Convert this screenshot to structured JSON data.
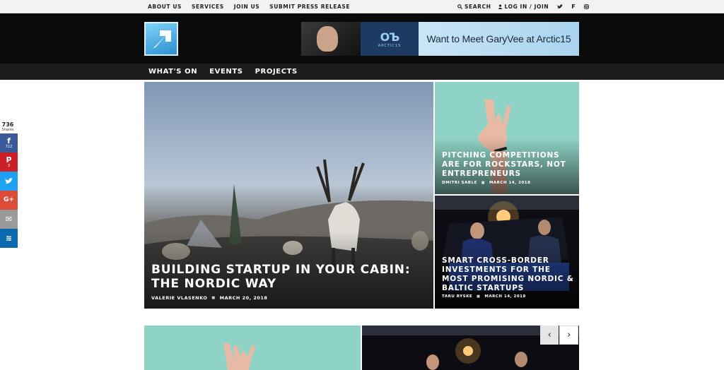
{
  "topbar": {
    "links": [
      "ABOUT US",
      "SERVICES",
      "JOIN US",
      "SUBMIT PRESS RELEASE"
    ],
    "search_label": "SEARCH",
    "login_label": "LOG IN / JOIN"
  },
  "banner": {
    "brand_mark": "ОЪ",
    "brand_sub": "ARCTIC15",
    "text": "Want to Meet GaryVee at Arctic15"
  },
  "mainnav": {
    "items": [
      "WHAT'S ON",
      "EVENTS",
      "PROJECTS"
    ]
  },
  "share": {
    "count": "736",
    "count_label": "Shares",
    "buttons": [
      {
        "icon": "facebook-icon",
        "glyph": "f",
        "count": "722",
        "color": "#3b5998"
      },
      {
        "icon": "pinterest-icon",
        "glyph": "P",
        "count": "3",
        "color": "#cb2027"
      },
      {
        "icon": "twitter-icon",
        "glyph": "t",
        "count": "",
        "color": "#1da1f2"
      },
      {
        "icon": "googleplus-icon",
        "glyph": "G+",
        "count": "",
        "color": "#dd4b39"
      },
      {
        "icon": "email-icon",
        "glyph": "✉",
        "count": "",
        "color": "#9a9a9a"
      },
      {
        "icon": "sumome-icon",
        "glyph": "≋",
        "count": "",
        "color": "#0a6ab0"
      }
    ]
  },
  "feature": {
    "title": "BUILDING STARTUP IN YOUR CABIN: THE NORDIC WAY",
    "author": "VALERIE VLASENKO",
    "date": "MARCH 20, 2018"
  },
  "side1": {
    "title": "PITCHING COMPETITIONS ARE FOR ROCKSTARS, NOT ENTREPRENEURS",
    "author": "DMITRI SABLE",
    "date": "MARCH 14, 2018"
  },
  "side2": {
    "title": "SMART CROSS-BORDER INVESTMENTS FOR THE MOST PROMISING NORDIC & BALTIC STARTUPS",
    "author": "TARU RYSKE",
    "date": "MARCH 14, 2018"
  },
  "carousel": {
    "prev_glyph": "‹",
    "next_glyph": "›"
  },
  "colors": {
    "teal": "#8fd3c6",
    "dark": "#0a0a0a",
    "nav": "#1c1c1c"
  }
}
